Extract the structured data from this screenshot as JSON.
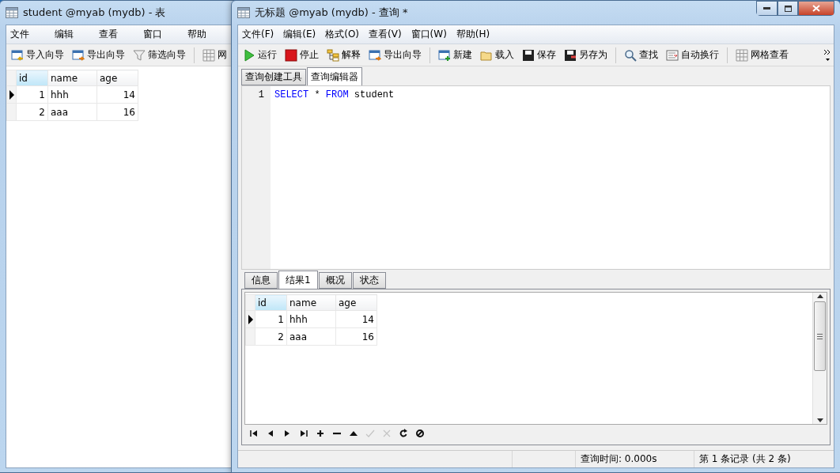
{
  "table_window": {
    "title": "student @myab (mydb) - 表",
    "menu": [
      "文件",
      "编辑",
      "查看",
      "窗口",
      "帮助"
    ],
    "toolbar": [
      {
        "kind": "import",
        "label": "导入向导"
      },
      {
        "kind": "export",
        "label": "导出向导"
      },
      {
        "kind": "filter",
        "label": "筛选向导"
      },
      {
        "kind": "grid",
        "label": "网"
      }
    ],
    "grid": {
      "columns": [
        {
          "label": "id",
          "selected": true
        },
        {
          "label": "name",
          "selected": false
        },
        {
          "label": "age",
          "selected": false
        }
      ],
      "rows": [
        {
          "cells": [
            "1",
            "hhh",
            "14"
          ],
          "selected": true
        },
        {
          "cells": [
            "2",
            "aaa",
            "16"
          ],
          "selected": false
        }
      ]
    }
  },
  "query_window": {
    "title": "无标题 @myab (mydb) - 查询 *",
    "menu": [
      "文件(F)",
      "编辑(E)",
      "格式(O)",
      "查看(V)",
      "窗口(W)",
      "帮助(H)"
    ],
    "toolbar": [
      {
        "kind": "run",
        "label": "运行"
      },
      {
        "kind": "stop",
        "label": "停止"
      },
      {
        "kind": "explain",
        "label": "解释"
      },
      {
        "kind": "export",
        "label": "导出向导"
      },
      {
        "kind": "new",
        "label": "新建"
      },
      {
        "kind": "load",
        "label": "载入"
      },
      {
        "kind": "save",
        "label": "保存"
      },
      {
        "kind": "saveas",
        "label": "另存为"
      },
      {
        "kind": "find",
        "label": "查找"
      },
      {
        "kind": "wrap",
        "label": "自动换行"
      },
      {
        "kind": "grid",
        "label": "网格查看"
      }
    ],
    "editor_tabs": [
      {
        "label": "查询创建工具",
        "selected": false
      },
      {
        "label": "查询编辑器",
        "selected": true
      }
    ],
    "editor_lines": [
      {
        "number": "1",
        "tokens": [
          {
            "text": "SELECT",
            "kind": "keyword"
          },
          {
            "text": " * ",
            "kind": "plain"
          },
          {
            "text": "FROM",
            "kind": "keyword"
          },
          {
            "text": " student",
            "kind": "plain"
          }
        ]
      }
    ],
    "result_tabs": [
      {
        "label": "信息",
        "selected": false
      },
      {
        "label": "结果1",
        "selected": true
      },
      {
        "label": "概况",
        "selected": false
      },
      {
        "label": "状态",
        "selected": false
      }
    ],
    "grid": {
      "columns": [
        {
          "label": "id",
          "selected": true
        },
        {
          "label": "name",
          "selected": false
        },
        {
          "label": "age",
          "selected": false
        }
      ],
      "rows": [
        {
          "cells": [
            "1",
            "hhh",
            "14"
          ],
          "selected": true
        },
        {
          "cells": [
            "2",
            "aaa",
            "16"
          ],
          "selected": false
        }
      ]
    },
    "nav_buttons": [
      {
        "kind": "first",
        "disabled": false
      },
      {
        "kind": "prev",
        "disabled": false
      },
      {
        "kind": "next",
        "disabled": false
      },
      {
        "kind": "last",
        "disabled": false
      },
      {
        "kind": "add",
        "disabled": false
      },
      {
        "kind": "remove",
        "disabled": false
      },
      {
        "kind": "up",
        "disabled": false
      },
      {
        "kind": "apply",
        "disabled": true
      },
      {
        "kind": "cancel",
        "disabled": true
      },
      {
        "kind": "refresh",
        "disabled": false
      },
      {
        "kind": "stop",
        "disabled": false
      }
    ],
    "status_bar": [
      "查询时间: 0.000s",
      "第 1 条记录 (共 2 条)"
    ]
  }
}
